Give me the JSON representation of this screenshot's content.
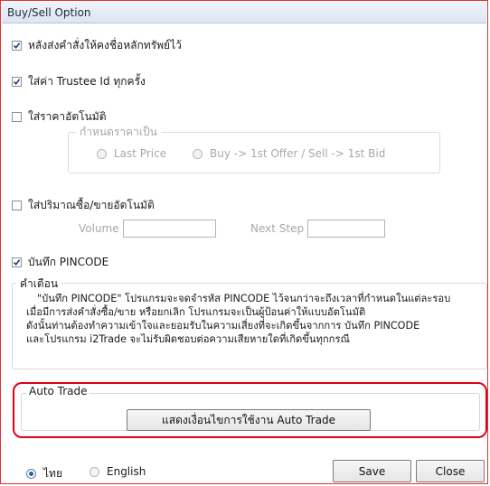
{
  "window": {
    "title": "Buy/Sell Option"
  },
  "options": {
    "keep_symbol": {
      "label": "หลังส่งคำสั่งให้คงชื่อหลักทรัพย์ไว้",
      "checked": true
    },
    "trustee_id": {
      "label": "ใส่ค่า Trustee Id ทุกครั้ง",
      "checked": true
    },
    "auto_price": {
      "label": "ใส่ราคาอัตโนมัติ",
      "checked": false
    },
    "auto_volume": {
      "label": "ใส่ปริมาณซื้อ/ขายอัตโนมัติ",
      "checked": false
    },
    "save_pincode": {
      "label": "บันทึก PINCODE",
      "checked": true
    }
  },
  "price_group": {
    "legend": "กำหนดราคาเป็น",
    "last_price": "Last Price",
    "offer_bid": "Buy -> 1st Offer / Sell -> 1st Bid"
  },
  "volume": {
    "label": "Volume",
    "value": ""
  },
  "next_step": {
    "label": "Next Step",
    "value": ""
  },
  "warning": {
    "legend": "คำเตือน",
    "lines": [
      "\"บันทึก PINCODE\" โปรแกรมจะจดจำรหัส PINCODE ไว้จนกว่าจะถึงเวลาที่กำหนดในแต่ละรอบ",
      "เมื่อมีการส่งคำสั่งซื้อ/ขาย หรือยกเลิก โปรแกรมจะเป็นผู้ป้อนค่าให้แบบอัตโนมัติ",
      "ดังนั้นท่านต้องทำความเข้าใจและยอมรับในความเสี่ยงที่จะเกิดขึ้นจากการ บันทึก PINCODE",
      "และโปรแกรม i2Trade จะไม่รับผิดชอบต่อความเสียหายใดที่เกิดขึ้นทุกกรณี"
    ]
  },
  "auto_trade": {
    "legend": "Auto Trade",
    "button": "แสดงเงื่อนไขการใช้งาน Auto Trade"
  },
  "language": {
    "thai": "ไทย",
    "english": "English",
    "selected": "thai"
  },
  "footer": {
    "save": "Save",
    "close": "Close"
  },
  "colors": {
    "highlight": "#e0001a",
    "accent": "#2c5ea8"
  }
}
